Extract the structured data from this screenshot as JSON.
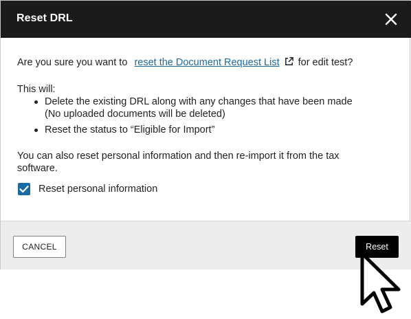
{
  "dialog": {
    "title": "Reset DRL",
    "intro_prefix": "Are you sure you want to",
    "link_text": "reset the Document Request List",
    "intro_suffix": "for edit test?",
    "this_will": "This will:",
    "bullets": [
      {
        "line1": "Delete the existing DRL along with any changes that have been made",
        "line2": "(No uploaded documents will be deleted)"
      },
      {
        "line1": "Reset the status to “Eligible for Import”"
      }
    ],
    "also_text": "You can also reset personal information and then re-import it from the tax software.",
    "checkbox_label": "Reset personal information",
    "checkbox_checked": true,
    "cancel_label": "CANCEL",
    "reset_label": "Reset"
  },
  "icons": {
    "close": "close-icon",
    "external_link": "external-link-icon",
    "check": "check-icon",
    "cursor": "mouse-pointer-icon"
  },
  "colors": {
    "header_bg": "#1b1b1b",
    "link": "#1a6aa3",
    "checkbox": "#1a6aa3",
    "primary_button": "#000000",
    "footer_bg": "#ededed"
  }
}
